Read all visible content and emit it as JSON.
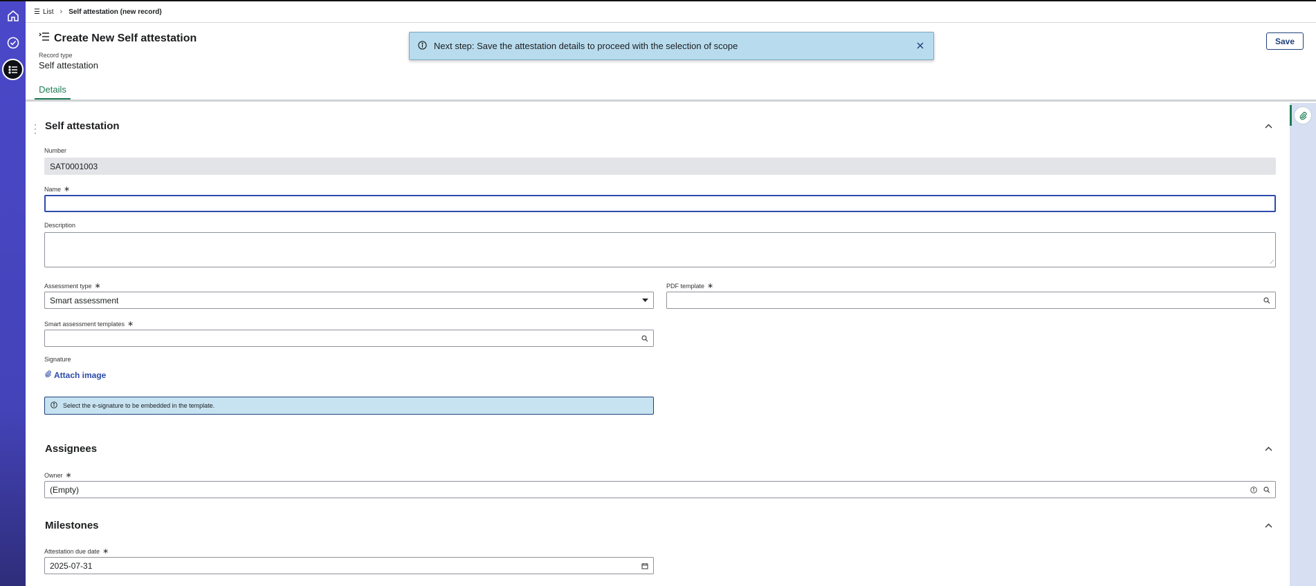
{
  "breadcrumb": {
    "list_label": "List",
    "current": "Self attestation (new record)"
  },
  "header": {
    "title": "Create New Self attestation",
    "record_type_label": "Record type",
    "record_type_value": "Self attestation",
    "tab_details": "Details",
    "save_label": "Save"
  },
  "toast": {
    "message": "Next step: Save the attestation details to proceed with the selection of scope"
  },
  "sections": {
    "self_attestation": {
      "title": "Self attestation",
      "number_label": "Number",
      "number_value": "SAT0001003",
      "name_label": "Name",
      "name_value": "",
      "description_label": "Description",
      "description_value": "",
      "assessment_type_label": "Assessment type",
      "assessment_type_value": "Smart assessment",
      "pdf_template_label": "PDF template",
      "pdf_template_value": "",
      "smart_templates_label": "Smart assessment templates",
      "smart_templates_value": "",
      "signature_label": "Signature",
      "attach_image_label": "Attach image",
      "signature_info": "Select the e-signature to be embedded in the template."
    },
    "assignees": {
      "title": "Assignees",
      "owner_label": "Owner",
      "owner_value": "(Empty)"
    },
    "milestones": {
      "title": "Milestones",
      "due_date_label": "Attestation due date",
      "due_date_value": "2025-07-31"
    }
  },
  "colors": {
    "rail": "#4b48c9",
    "accent_green": "#1c7a54",
    "primary_blue": "#1c3f7a",
    "toast_bg": "#b8dcee"
  },
  "icons": [
    "home-icon",
    "check-circle-icon",
    "list-icon",
    "search-icon",
    "info-icon",
    "close-icon",
    "paperclip-icon",
    "calendar-icon",
    "chevron-up-icon",
    "caret-down-icon"
  ]
}
